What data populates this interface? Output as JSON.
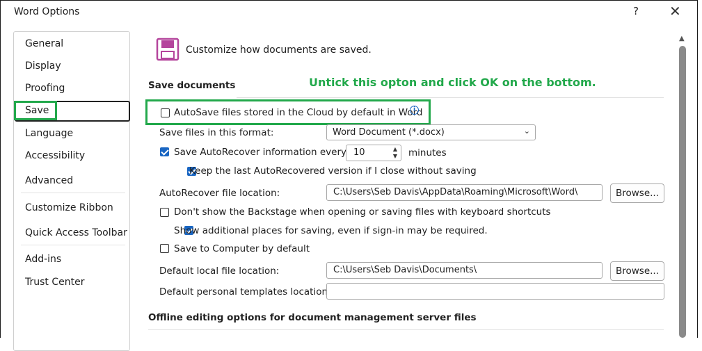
{
  "window": {
    "title": "Word Options",
    "help_label": "?",
    "close_label": "✕"
  },
  "sidebar": {
    "items": [
      {
        "label": "General"
      },
      {
        "label": "Display"
      },
      {
        "label": "Proofing"
      },
      {
        "label": "Save"
      },
      {
        "label": "Language"
      },
      {
        "label": "Accessibility"
      },
      {
        "label": "Advanced"
      },
      {
        "label": "Customize Ribbon"
      },
      {
        "label": "Quick Access Toolbar"
      },
      {
        "label": "Add-ins"
      },
      {
        "label": "Trust Center"
      }
    ],
    "selected": "Save"
  },
  "main": {
    "header": "Customize how documents are saved.",
    "save_section_title": "Save documents",
    "annotation": "Untick this opton and click OK on the bottom.",
    "autosave_label": "AutoSave files stored in the Cloud by default in Word",
    "autosave_checked": false,
    "format_label": "Save files in this format:",
    "format_value": "Word Document (*.docx)",
    "autorecover_label": "Save AutoRecover information every",
    "autorecover_checked": true,
    "autorecover_minutes": "10",
    "minutes_label": "minutes",
    "keep_last_label": "Keep the last AutoRecovered version if I close without saving",
    "keep_last_checked": true,
    "autorecover_location_label": "AutoRecover file location:",
    "autorecover_location_value": "C:\\Users\\Seb Davis\\AppData\\Roaming\\Microsoft\\Word\\",
    "browse_label": "Browse...",
    "backstage_label": "Don't show the Backstage when opening or saving files with keyboard shortcuts",
    "backstage_checked": false,
    "additional_places_label": "Show additional places for saving, even if sign-in may be required.",
    "additional_places_checked": true,
    "save_computer_label": "Save to Computer by default",
    "save_computer_checked": false,
    "default_local_label": "Default local file location:",
    "default_local_value": "C:\\Users\\Seb Davis\\Documents\\",
    "default_templates_label": "Default personal templates location:",
    "default_templates_value": "",
    "offline_section_title": "Offline editing options for document management server files"
  },
  "colors": {
    "accent": "#1a66c2",
    "annotation_green": "#21a84a",
    "icon_purple": "#b4449c"
  }
}
